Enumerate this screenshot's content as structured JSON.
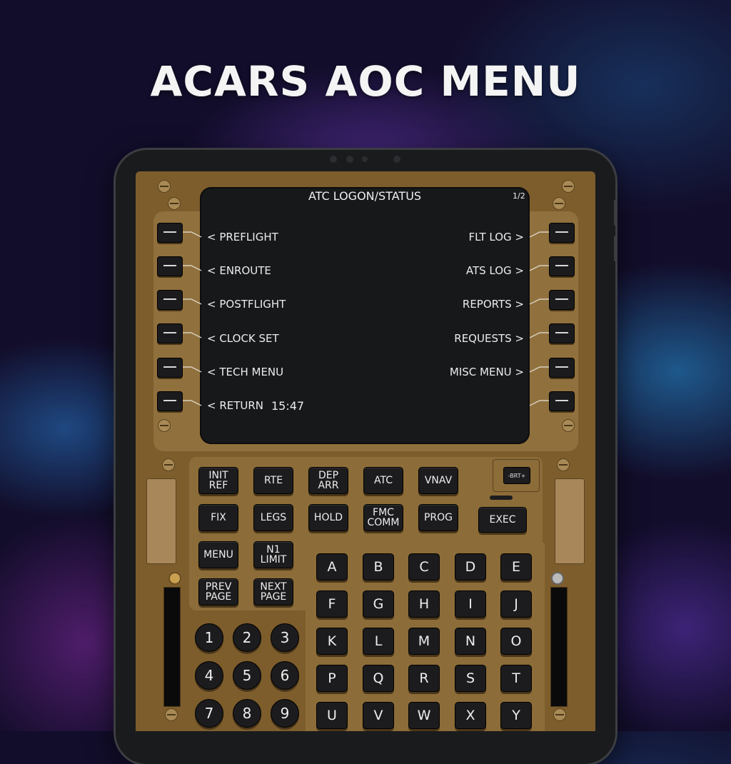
{
  "header": {
    "title": "ACARS AOC MENU"
  },
  "screen": {
    "title": "ATC LOGON/STATUS",
    "page": "1/2",
    "left_items": [
      "< PREFLIGHT",
      "< ENROUTE",
      "< POSTFLIGHT",
      "< CLOCK SET",
      "< TECH MENU",
      "< RETURN"
    ],
    "right_items": [
      "FLT LOG >",
      "ATS LOG >",
      "REPORTS >",
      "REQUESTS >",
      "MISC MENU >"
    ],
    "time": "15:47"
  },
  "function_keys": {
    "init_ref": "INIT\nREF",
    "rte": "RTE",
    "dep_arr": "DEP\nARR",
    "atc": "ATC",
    "vnav": "VNAV",
    "fix": "FIX",
    "legs": "LEGS",
    "hold": "HOLD",
    "fmc_comm": "FMC\nCOMM",
    "prog": "PROG",
    "exec": "EXEC",
    "menu": "MENU",
    "n1_limit": "N1\nLIMIT",
    "prev_page": "PREV\nPAGE",
    "next_page": "NEXT\nPAGE",
    "brt": "-BRT+"
  },
  "alpha_keys": [
    "A",
    "B",
    "C",
    "D",
    "E",
    "F",
    "G",
    "H",
    "I",
    "J",
    "K",
    "L",
    "M",
    "N",
    "O",
    "P",
    "Q",
    "R",
    "S",
    "T",
    "U",
    "V",
    "W",
    "X",
    "Y"
  ],
  "num_keys": [
    "1",
    "2",
    "3",
    "4",
    "5",
    "6",
    "7",
    "8",
    "9"
  ],
  "colors": {
    "panel": "#7d5d2c",
    "screen": "#17181a",
    "key": "#1c1c1e"
  }
}
